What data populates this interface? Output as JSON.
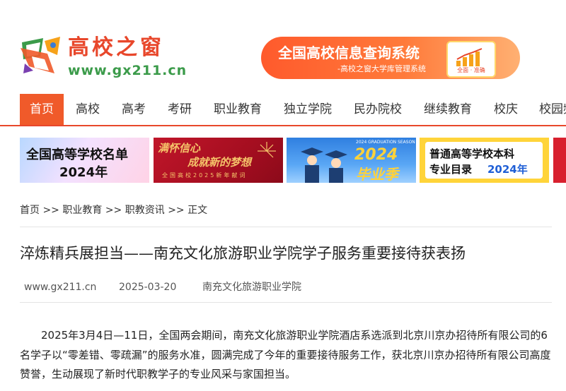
{
  "site": {
    "logo_title": "高校之窗",
    "logo_url": "www.gx211.cn"
  },
  "banner": {
    "title": "全国高校信息查询系统",
    "subtitle": "-高校之窗大学库管理系统",
    "card_label": "全面 · 准确"
  },
  "nav": {
    "items": [
      "首页",
      "高校",
      "高考",
      "考研",
      "职业教育",
      "独立学院",
      "民办院校",
      "继续教育",
      "校庆",
      "校园频"
    ]
  },
  "promos": {
    "p1": {
      "line1": "全国高等学校名单",
      "line2": "2024年"
    },
    "p2": {
      "line1": "满怀信心",
      "line2": "成就新的梦想",
      "caption": "全国高校2025新年献词"
    },
    "p3": {
      "caption": "2024 GRADUATION SEASON",
      "big": "2024",
      "word": "毕业季"
    },
    "p4": {
      "line1": "普通高等学校本科",
      "line2a": "专业目录",
      "line2b": "2024年"
    }
  },
  "breadcrumb": {
    "items": [
      "首页",
      "职业教育",
      "职教资讯",
      "正文"
    ],
    "separator": ">>"
  },
  "article": {
    "title": "淬炼精兵展担当——南充文化旅游职业学院学子服务重要接待获表扬",
    "source_site": "www.gx211.cn",
    "date": "2025-03-20",
    "author": "南充文化旅游职业学院",
    "paragraph": "2025年3月4日—11日，全国两会期间，南充文化旅游职业学院酒店系选派到北京川京办招待所有限公司的6名学子以“零差错、零疏漏”的服务水准，圆满完成了今年的重要接待服务工作，获北京川京办招待所有限公司高度赞誉，生动展现了新时代职教学子的专业风采与家国担当。"
  },
  "colors": {
    "accent": "#f05a2a",
    "logo_red": "#e8472b",
    "logo_green": "#3b9b4a"
  }
}
